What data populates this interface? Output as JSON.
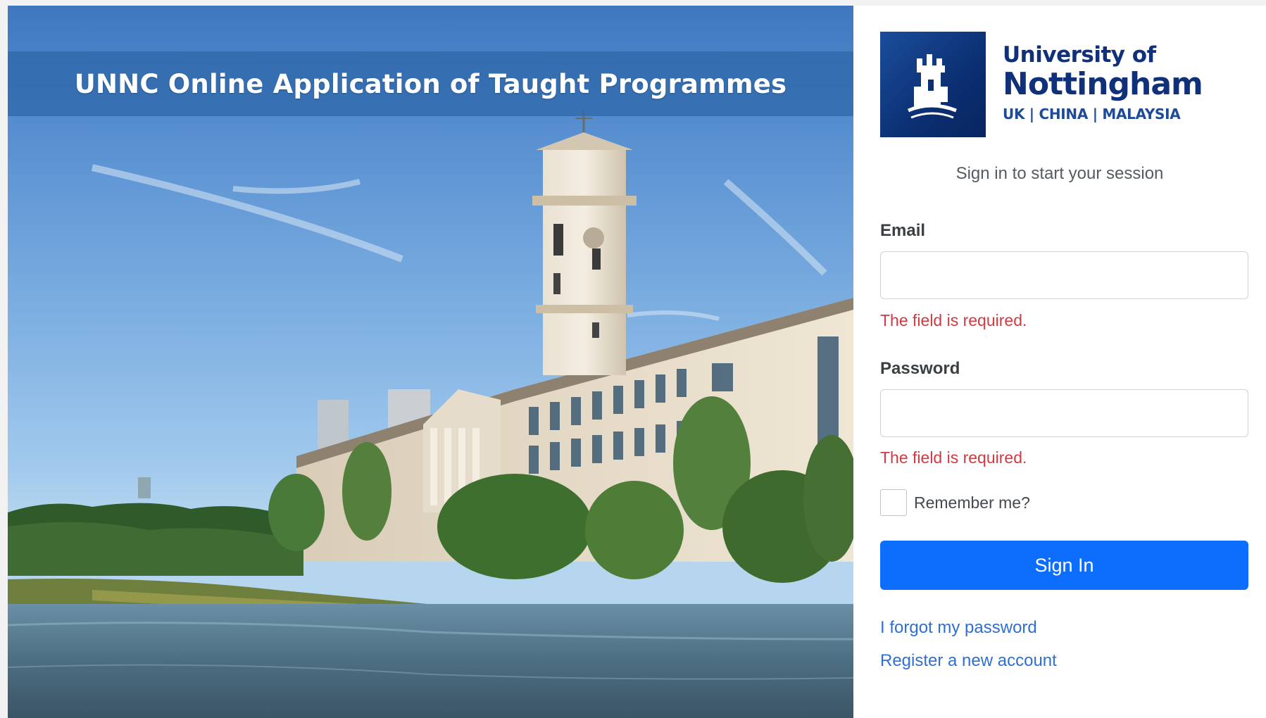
{
  "hero": {
    "title": "UNNC Online Application of Taught Programmes"
  },
  "logo": {
    "line1": "University of",
    "line2": "Nottingham",
    "line3": "UK | CHINA | MALAYSIA"
  },
  "login": {
    "subtitle": "Sign in to start your session",
    "email_label": "Email",
    "email_value": "",
    "email_error": "The field is required.",
    "password_label": "Password",
    "password_value": "",
    "password_error": "The field is required.",
    "remember_label": "Remember me?",
    "remember_checked": false,
    "signin_label": "Sign In",
    "forgot_link": "I forgot my password",
    "register_link": "Register a new account"
  },
  "colors": {
    "primary_button": "#0d6efd",
    "error_text": "#d13a42",
    "link": "#2f6fd1",
    "brand_navy": "#10307a"
  }
}
